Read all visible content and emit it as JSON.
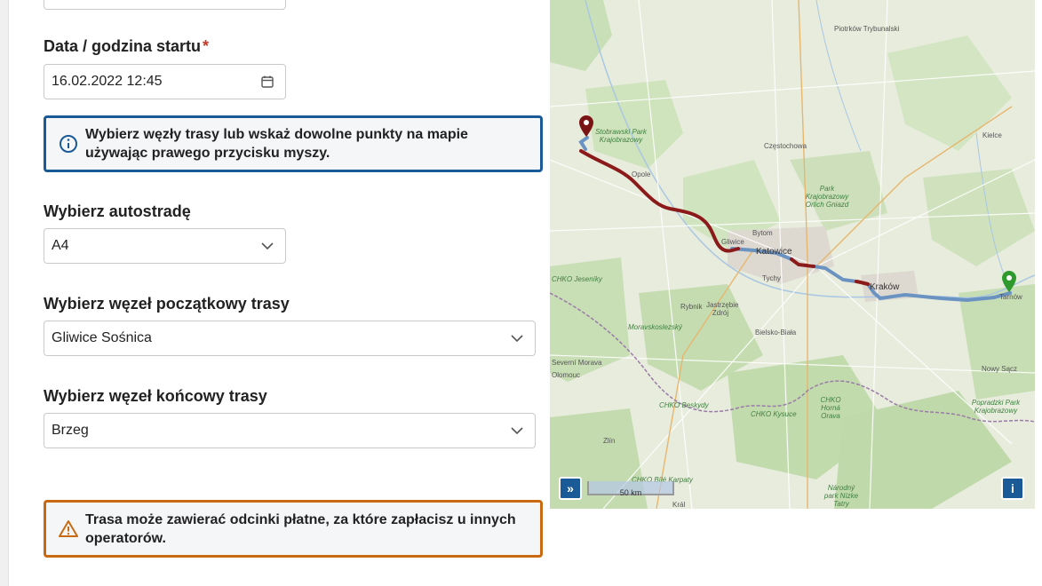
{
  "form": {
    "start_label": "Data / godzina startu",
    "required_mark": "*",
    "start_value": "16.02.2022 12:45",
    "info_text": "Wybierz węzły trasy lub wskaż dowolne punkty na mapie używając prawego przycisku myszy.",
    "motorway_label": "Wybierz autostradę",
    "motorway_value": "A4",
    "from_label": "Wybierz węzeł początkowy trasy",
    "from_value": "Gliwice Sośnica",
    "to_label": "Wybierz węzeł końcowy trasy",
    "to_value": "Brzeg",
    "warning_text": "Trasa może zawierać odcinki płatne, za które zapłacisz u innych operatorów."
  },
  "map": {
    "labels": {
      "piotrkow": "Piotrków Trybunalski",
      "czestochowa": "Częstochowa",
      "kielce": "Kielce",
      "opole": "Opole",
      "gliwice": "Gliwice",
      "bytom": "Bytom",
      "katowice": "Katowice",
      "krakow": "Kraków",
      "tarnow": "Tarnów",
      "rybnik": "Rybnik",
      "jastrzebie": "Jastrzębie Zdrój",
      "tychy": "Tychy",
      "bielsko": "Bielsko-Biała",
      "nowy_sacz": "Nowy Sącz",
      "zlin": "Zlín",
      "stobrawski": "Stobrawski Park Krajobrazowy",
      "orle_gniazda": "Park Krajobrazowy Orlich Gniazd",
      "beskydy": "CHKO Beskydy",
      "kysuce": "CHKO Kysuce",
      "horna_orava": "CHKO Horná Orava",
      "poprad": "Popradzki Park Krajobrazowy",
      "moravskoslezsky": "Moravskoslezský",
      "jeseniky": "CHKO Jeseníky",
      "morava": "Severní Morava",
      "olomouc": "Olomouc",
      "narodny_park": "Národný park Nízke Tatry",
      "chko_bile": "CHKO Bílé Karpaty",
      "kral": "Král"
    },
    "scale": "50 km",
    "expand_button": "»",
    "info_button": "i",
    "colors": {
      "route_toll": "#8b1a1a",
      "route_free": "#6b93c2",
      "start_marker": "#7a1414",
      "end_marker": "#2e9a2e"
    }
  }
}
